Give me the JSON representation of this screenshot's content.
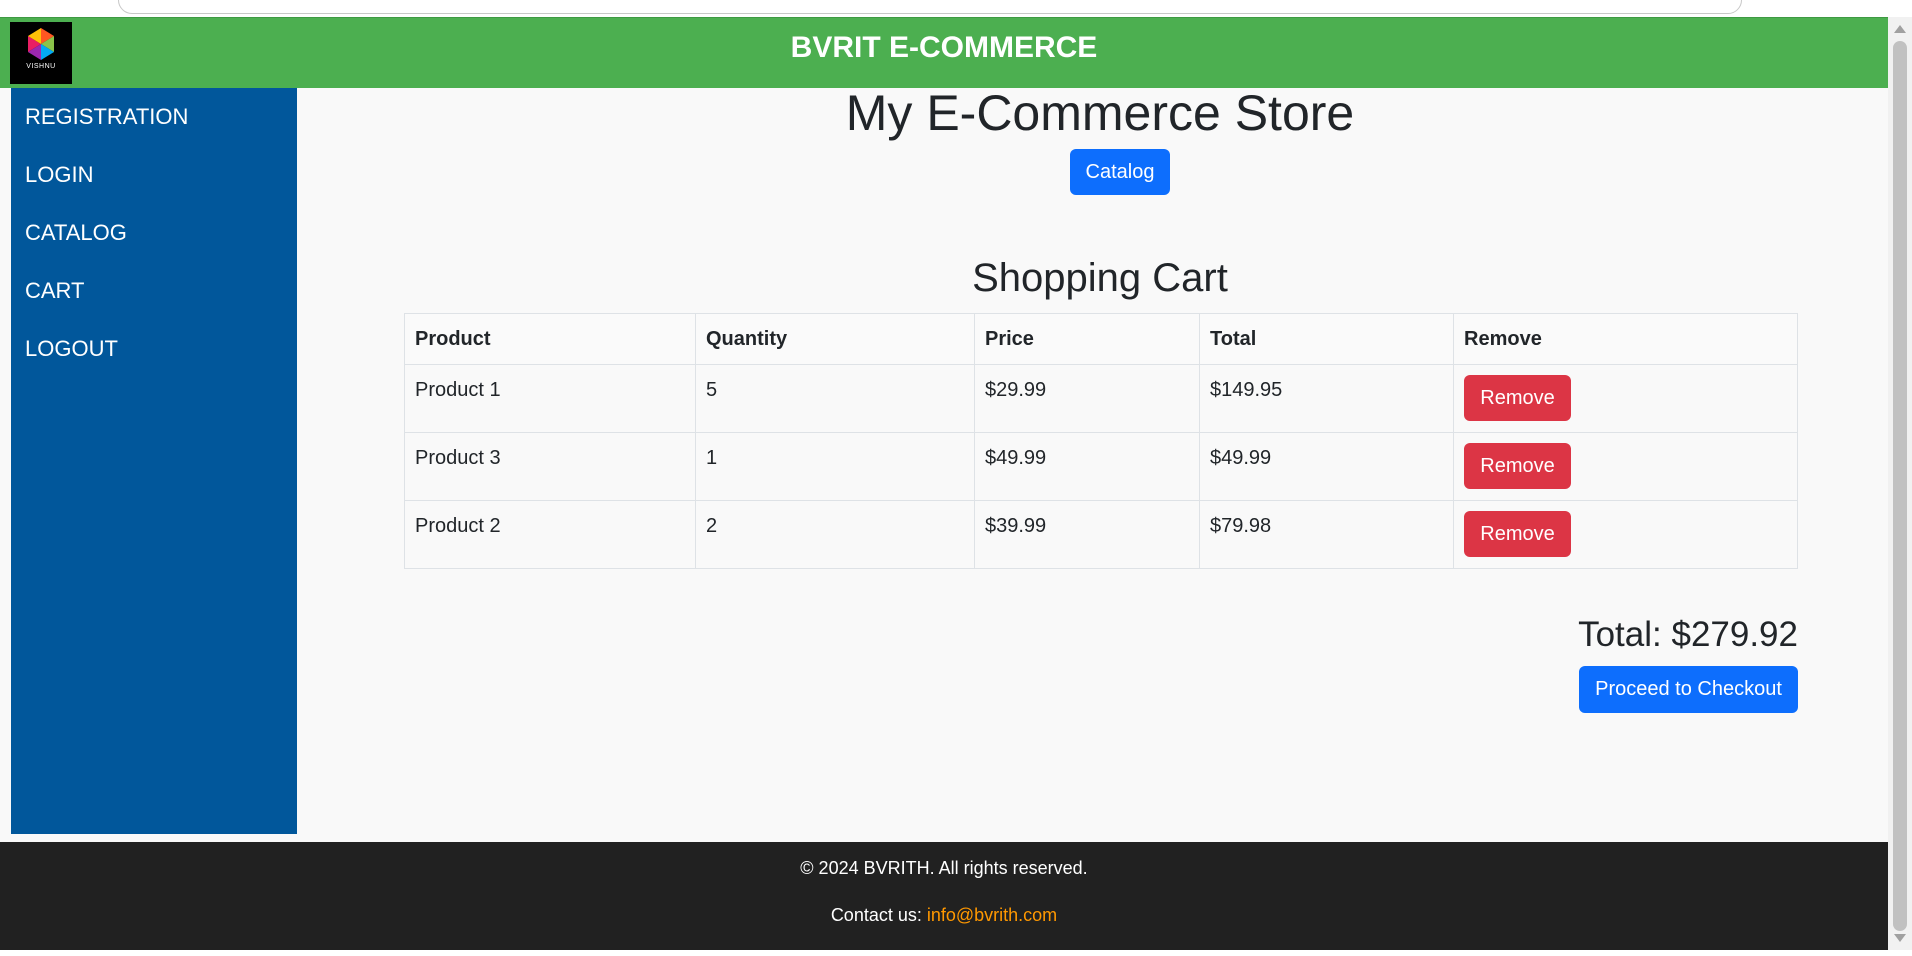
{
  "header": {
    "title": "BVRIT E-COMMERCE",
    "logo_text": "VISHNU"
  },
  "sidebar": {
    "items": [
      {
        "label": "REGISTRATION"
      },
      {
        "label": "LOGIN"
      },
      {
        "label": "CATALOG"
      },
      {
        "label": "CART"
      },
      {
        "label": "LOGOUT"
      }
    ]
  },
  "main": {
    "store_title": "My E-Commerce Store",
    "catalog_button": "Catalog",
    "cart_title": "Shopping Cart",
    "table": {
      "headers": [
        "Product",
        "Quantity",
        "Price",
        "Total",
        "Remove"
      ],
      "rows": [
        {
          "product": "Product 1",
          "quantity": "5",
          "price": "$29.99",
          "total": "$149.95",
          "remove_label": "Remove"
        },
        {
          "product": "Product 3",
          "quantity": "1",
          "price": "$49.99",
          "total": "$49.99",
          "remove_label": "Remove"
        },
        {
          "product": "Product 2",
          "quantity": "2",
          "price": "$39.99",
          "total": "$79.98",
          "remove_label": "Remove"
        }
      ]
    },
    "total_text": "Total: $279.92",
    "checkout_button": "Proceed to Checkout"
  },
  "footer": {
    "copyright": "© 2024 BVRITH. All rights reserved.",
    "contact_label": "Contact us: ",
    "contact_email": "info@bvrith.com"
  },
  "colors": {
    "header_bg": "#4caf50",
    "sidebar_bg": "#01579b",
    "primary_button": "#0d6efd",
    "danger_button": "#dc3545",
    "footer_bg": "#212121",
    "link_accent": "#ff9800"
  }
}
